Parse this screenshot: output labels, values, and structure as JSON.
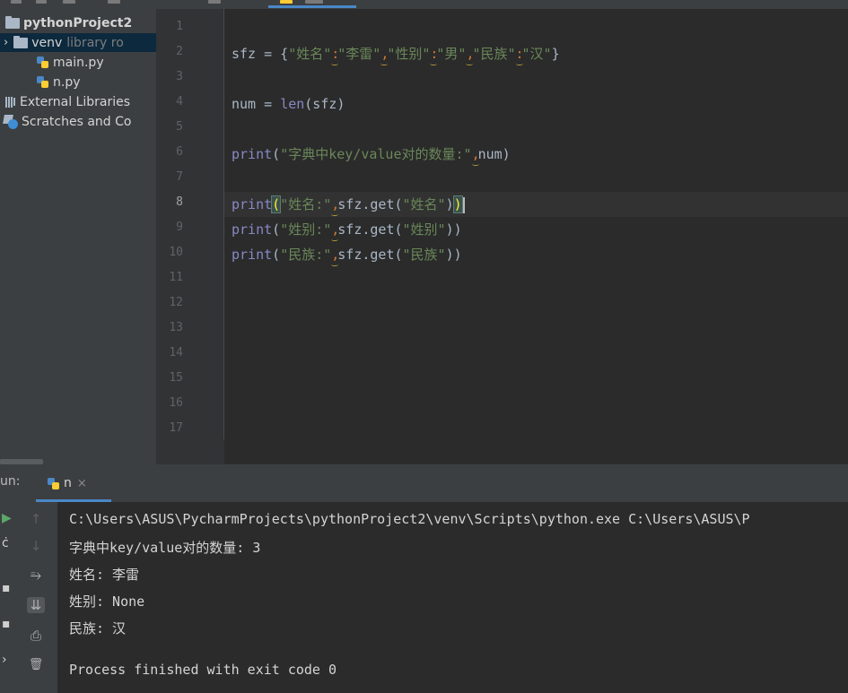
{
  "project": {
    "root": "pythonProject2",
    "venv_name": "venv",
    "venv_note": "library ro",
    "files": [
      "main.py",
      "n.py"
    ],
    "external_libraries": "External Libraries",
    "scratches": "Scratches and Co"
  },
  "editor": {
    "line_numbers": [
      "1",
      "2",
      "3",
      "4",
      "5",
      "6",
      "7",
      "8",
      "9",
      "10",
      "11",
      "12",
      "13",
      "14",
      "15",
      "16",
      "17"
    ],
    "current_line": "8",
    "code": {
      "l2_var": "sfz = {",
      "k1": "\"姓名\"",
      "v1": "\"李雷\"",
      "k2": "\"性别\"",
      "v2": "\"男\"",
      "k3": "\"民族\"",
      "v3": "\"汉\"",
      "close_brace": "}",
      "colon": ":",
      "comma": ",",
      "l4_lhs": "num = ",
      "l4_fn": "len",
      "l4_rest": "(sfz)",
      "print": "print",
      "l6_str": "\"字典中key/value对的数量:\"",
      "l6_tail": "num)",
      "open_paren": "(",
      "close_paren": ")",
      "l8_str": "\"姓名:\"",
      "l8_call": "sfz.get(",
      "l8_arg": "\"姓名\"",
      "l9_str": "\"姓别:\"",
      "l9_call": "sfz.get(",
      "l9_arg": "\"姓别\"",
      "l9_end": "))",
      "l10_str": "\"民族:\"",
      "l10_call": "sfz.get(",
      "l10_arg": "\"民族\"",
      "l10_end": "))"
    }
  },
  "run": {
    "label": "un:",
    "tab_name": "n",
    "tab_close": "×",
    "output": [
      "C:\\Users\\ASUS\\PycharmProjects\\pythonProject2\\venv\\Scripts\\python.exe C:\\Users\\ASUS\\P",
      "字典中key/value对的数量: 3",
      "姓名: 李雷",
      "姓别: None",
      "民族: 汉",
      "",
      "Process finished with exit code 0"
    ],
    "tools": {
      "up": "↑",
      "down": "↓",
      "soft_wrap": "⥱",
      "scroll_to_end": "⇊",
      "print": "⎙",
      "trash": "🗑"
    }
  },
  "colors": {
    "editor_bg": "#2b2b2b",
    "panel_bg": "#3c3f41",
    "string": "#6a8759",
    "accent": "#4a88c7",
    "bracket_match": "#ffef28"
  }
}
